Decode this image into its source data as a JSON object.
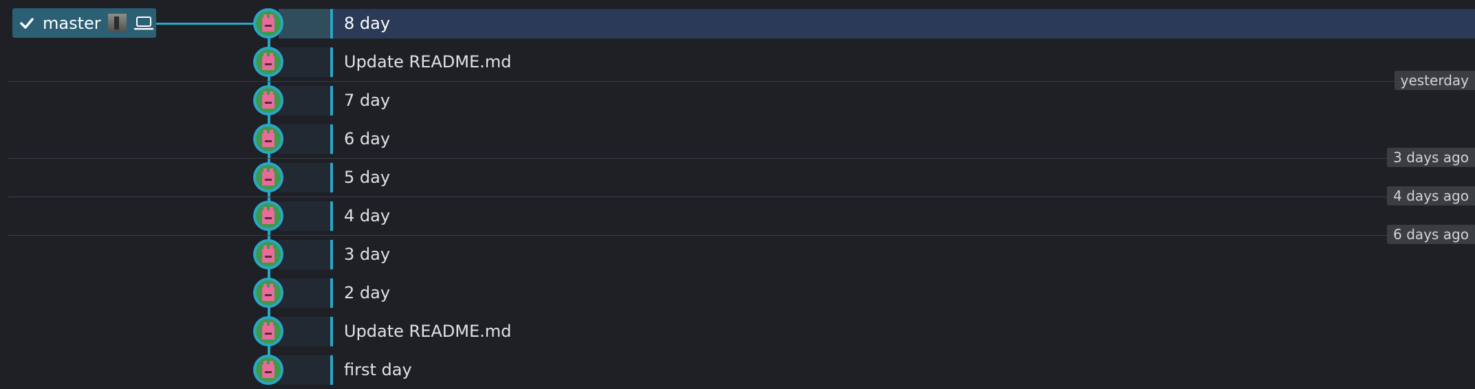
{
  "branch": {
    "name": "master",
    "icons": [
      "check-icon",
      "avatar",
      "laptop-icon"
    ]
  },
  "commits": [
    {
      "message": "8 day",
      "selected": true
    },
    {
      "message": "Update README.md",
      "selected": false
    },
    {
      "message": "7 day",
      "selected": false
    },
    {
      "message": "6 day",
      "selected": false
    },
    {
      "message": "5 day",
      "selected": false
    },
    {
      "message": "4 day",
      "selected": false
    },
    {
      "message": "3 day",
      "selected": false
    },
    {
      "message": "2 day",
      "selected": false
    },
    {
      "message": "Update README.md",
      "selected": false
    },
    {
      "message": "first day",
      "selected": false
    }
  ],
  "date_separators": [
    {
      "label": "yesterday"
    },
    {
      "label": "3 days ago"
    },
    {
      "label": "4 days ago"
    },
    {
      "label": "6 days ago"
    }
  ],
  "colors": {
    "accent": "#2aa6c8",
    "selected_row": "#2b3a57",
    "branch_bg": "#2a5f74",
    "avatar_green": "#3d9a4a",
    "avatar_pink": "#e86b9a"
  }
}
